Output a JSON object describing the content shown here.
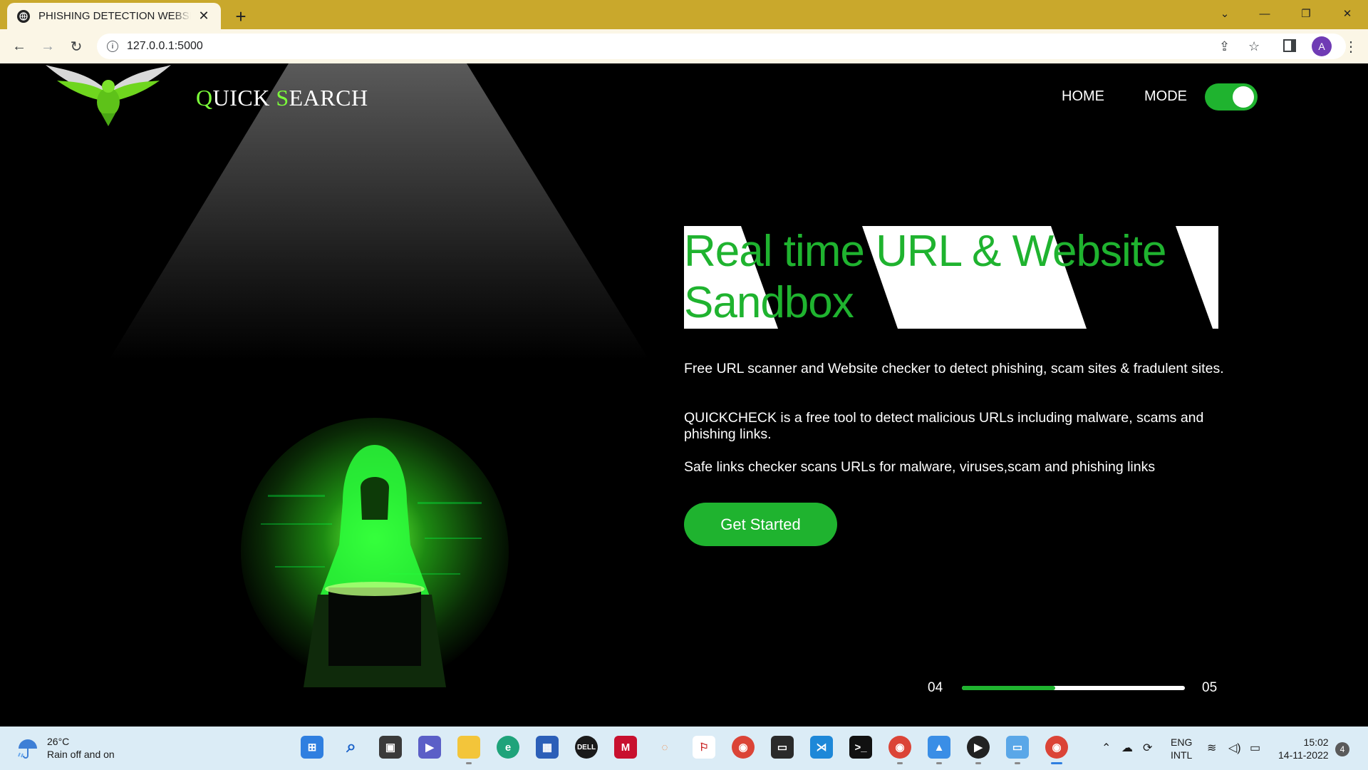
{
  "browser": {
    "tab_title": "PHISHING DETECTION WEBSITE",
    "tab_close": "✕",
    "new_tab": "+",
    "url": "127.0.0.1:5000",
    "profile_initial": "A",
    "window_controls": {
      "dropdown": "⌄",
      "minimize": "—",
      "restore": "❐",
      "close": "✕"
    }
  },
  "site": {
    "brand_first_cap": "Q",
    "brand_first_rest": "UICK ",
    "brand_second_cap": "S",
    "brand_second_rest": "EARCH",
    "nav_home": "HOME",
    "nav_mode": "MODE",
    "mode_toggle_on": true
  },
  "hero": {
    "headline": "Real time URL & Website Sandbox",
    "para1": "Free URL scanner and Website checker to detect phishing, scam sites & fradulent sites.",
    "para2": "QUICKCHECK is a free tool to detect malicious URLs including malware, scams and phishing links.",
    "para3": "Safe links checker scans URLs for malware, viruses,scam and phishing links",
    "cta": "Get Started"
  },
  "slider": {
    "current": "04",
    "total": "05",
    "progress": 0.42
  },
  "colors": {
    "accent": "#1fb32f",
    "tab_bar": "#c9a82c",
    "toolbar": "#fbf6e6"
  },
  "taskbar": {
    "weather_temp": "26°C",
    "weather_desc": "Rain off and on",
    "lang_line1": "ENG",
    "lang_line2": "INTL",
    "time": "15:02",
    "date": "14-11-2022",
    "notifications": "4"
  }
}
